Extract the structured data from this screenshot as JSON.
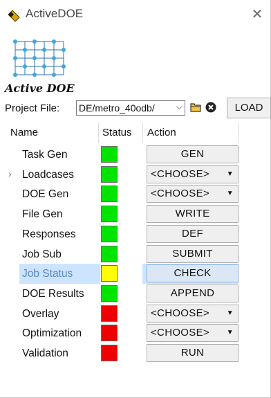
{
  "window": {
    "title": "ActiveDOE",
    "close_glyph": "✕"
  },
  "logo": {
    "text": "Active DOE",
    "icon": "grid-logo-icon"
  },
  "project": {
    "label": "Project File:",
    "value": "DE/metro_40odb/",
    "chevron": "⌵",
    "load_label": "LOAD",
    "folder_icon": "folder-icon",
    "clear_icon": "clear-icon"
  },
  "table": {
    "headers": {
      "name": "Name",
      "status": "Status",
      "action": "Action"
    },
    "rows": [
      {
        "name": "Task  Gen",
        "status": "green",
        "action": "GEN",
        "choose": false,
        "expander": ""
      },
      {
        "name": "Loadcases",
        "status": "green",
        "action": "<CHOOSE>",
        "choose": true,
        "expander": "›"
      },
      {
        "name": "DOE  Gen",
        "status": "green",
        "action": "<CHOOSE>",
        "choose": true,
        "expander": ""
      },
      {
        "name": "File  Gen",
        "status": "green",
        "action": "WRITE",
        "choose": false,
        "expander": ""
      },
      {
        "name": "Responses",
        "status": "green",
        "action": "DEF",
        "choose": false,
        "expander": ""
      },
      {
        "name": "Job  Sub",
        "status": "green",
        "action": "SUBMIT",
        "choose": false,
        "expander": ""
      },
      {
        "name": "Job Status",
        "status": "yellow",
        "action": "CHECK",
        "choose": false,
        "expander": "",
        "selected": true
      },
      {
        "name": "DOE Results",
        "status": "green",
        "action": "APPEND",
        "choose": false,
        "expander": ""
      },
      {
        "name": "Overlay",
        "status": "red",
        "action": "<CHOOSE>",
        "choose": true,
        "expander": ""
      },
      {
        "name": "Optimization",
        "status": "red",
        "action": "<CHOOSE>",
        "choose": true,
        "expander": ""
      },
      {
        "name": "Validation",
        "status": "red",
        "action": "RUN",
        "choose": false,
        "expander": ""
      }
    ]
  },
  "colors": {
    "green": "#00e400",
    "yellow": "#ffff00",
    "red": "#ee0000",
    "selection": "#cce4ff"
  }
}
